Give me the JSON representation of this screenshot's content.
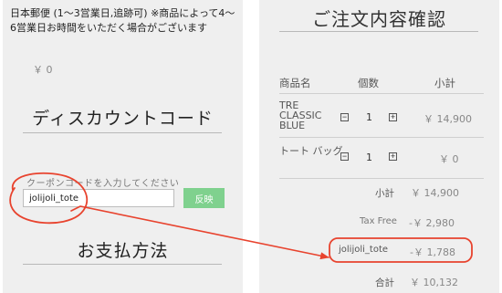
{
  "left_panel": {
    "shipping_text": "日本郵便 (1〜3営業日,追跡可) ※商品によって4〜6営業日お時間をいただく場合がございます",
    "shipping_price": "￥ 0",
    "discount_heading": "ディスカウントコード",
    "coupon_label": "クーポンコードを入力してください",
    "coupon_value": "jolijoli_tote",
    "apply_button": "反映",
    "payment_heading": "お支払方法"
  },
  "right_panel": {
    "heading": "ご注文内容確認",
    "columns": {
      "name": "商品名",
      "qty": "個数",
      "subtotal": "小計"
    },
    "items": [
      {
        "name": "TRE CLASSIC BLUE",
        "qty": "1",
        "price": "￥ 14,900"
      },
      {
        "name": "トート バッグ",
        "qty": "1",
        "price": "￥ 0"
      }
    ],
    "stepper": {
      "minus": "−",
      "plus": "+"
    },
    "subtotal": {
      "label": "小計",
      "value": "￥ 14,900"
    },
    "tax_free": {
      "label": "Tax Free",
      "value": "-￥ 2,980"
    },
    "coupon": {
      "label": "jolijoli_tote",
      "value": "-￥ 1,788"
    },
    "total": {
      "label": "合計",
      "value": "￥ 10,132"
    }
  },
  "colors": {
    "apply_button": "#7fd18e",
    "annotation": "#e8432e",
    "panel_background": "#efefef"
  }
}
